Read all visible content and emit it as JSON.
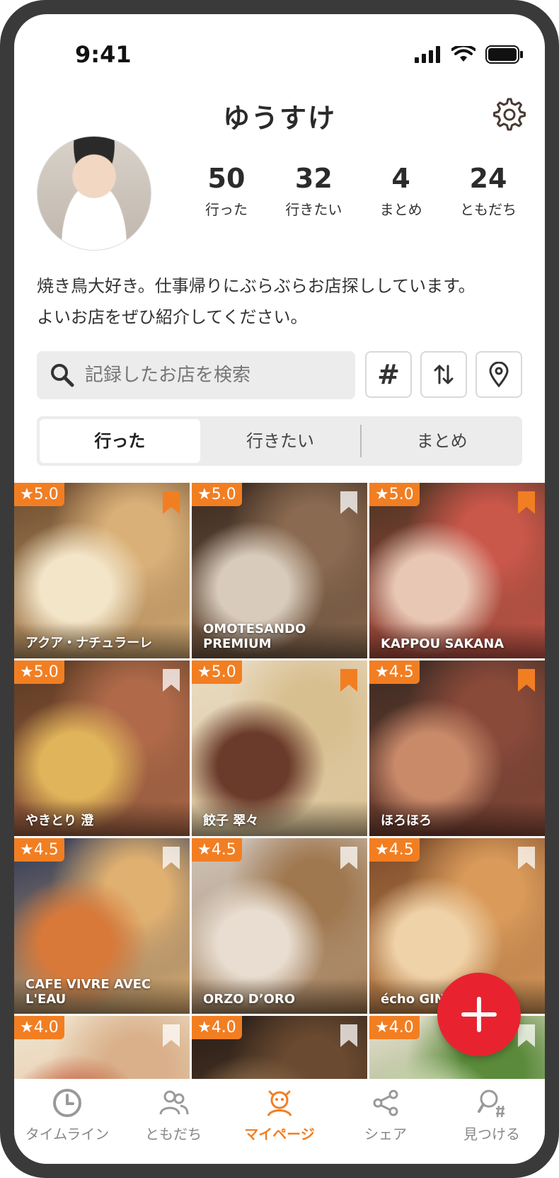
{
  "status_bar": {
    "time": "9:41"
  },
  "profile": {
    "username": "ゆうすけ",
    "stats": [
      {
        "value": "50",
        "label": "行った"
      },
      {
        "value": "32",
        "label": "行きたい"
      },
      {
        "value": "4",
        "label": "まとめ"
      },
      {
        "value": "24",
        "label": "ともだち"
      }
    ],
    "bio_line1": "焼き鳥大好き。仕事帰りにぶらぶらお店探ししています。",
    "bio_line2": "よいお店をぜひ紹介してください。"
  },
  "search": {
    "placeholder": "記録したお店を検索"
  },
  "tools": {
    "hashtag": "#"
  },
  "tabs": [
    {
      "label": "行った"
    },
    {
      "label": "行きたい"
    },
    {
      "label": "まとめ"
    }
  ],
  "restaurants": [
    {
      "rating": "★5.0",
      "name": "アクア・ナチュラーレ",
      "bookmarked": true,
      "colors": [
        "#6b4a2e",
        "#d9b078",
        "#f3e5c8"
      ]
    },
    {
      "rating": "★5.0",
      "name": "OMOTESANDO PREMIUM",
      "bookmarked": false,
      "colors": [
        "#3b2a20",
        "#8a6a50",
        "#d8cbbb"
      ]
    },
    {
      "rating": "★5.0",
      "name": "KAPPOU SAKANA",
      "bookmarked": true,
      "colors": [
        "#4a3322",
        "#c9574a",
        "#e9c7b5"
      ]
    },
    {
      "rating": "★5.0",
      "name": "やきとり 澄",
      "bookmarked": false,
      "colors": [
        "#5a3a22",
        "#b06a4a",
        "#e0b45a"
      ]
    },
    {
      "rating": "★5.0",
      "name": "餃子 翠々",
      "bookmarked": true,
      "colors": [
        "#e9dcc4",
        "#d8bf90",
        "#6a3a2a"
      ]
    },
    {
      "rating": "★4.5",
      "name": "ほろほろ",
      "bookmarked": true,
      "colors": [
        "#3a2a22",
        "#8a4a3a",
        "#c98a6a"
      ]
    },
    {
      "rating": "★4.5",
      "name": "CAFE VIVRE AVEC L'EAU",
      "bookmarked": false,
      "colors": [
        "#2e3a5a",
        "#e0b070",
        "#d8793a"
      ]
    },
    {
      "rating": "★4.5",
      "name": "ORZO D’ORO",
      "bookmarked": false,
      "colors": [
        "#cfc6bd",
        "#a07850",
        "#e8ddd0"
      ]
    },
    {
      "rating": "★4.5",
      "name": "écho GINZ",
      "bookmarked": false,
      "colors": [
        "#7a4a2a",
        "#d99a5a",
        "#f0d2a8"
      ]
    },
    {
      "rating": "★4.0",
      "name": "",
      "bookmarked": false,
      "colors": [
        "#f1e5d0",
        "#d9b08a",
        "#c86a4a"
      ]
    },
    {
      "rating": "★4.0",
      "name": "",
      "bookmarked": false,
      "colors": [
        "#2a1e18",
        "#6a4a30",
        "#8a6a4a"
      ]
    },
    {
      "rating": "★4.0",
      "name": "",
      "bookmarked": false,
      "colors": [
        "#e9e0d0",
        "#5a8a3a",
        "#c8d8b0"
      ]
    }
  ],
  "bottom_nav": [
    {
      "label": "タイムライン",
      "icon": "clock-icon"
    },
    {
      "label": "ともだち",
      "icon": "friends-icon"
    },
    {
      "label": "マイページ",
      "icon": "mypage-icon"
    },
    {
      "label": "シェア",
      "icon": "share-icon"
    },
    {
      "label": "見つける",
      "icon": "discover-icon"
    }
  ],
  "colors": {
    "accent": "#f27e22",
    "fab": "#e8232f"
  }
}
